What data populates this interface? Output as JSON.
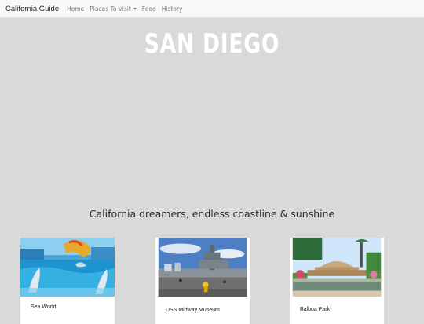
{
  "navbar": {
    "brand": "California Guide",
    "links": [
      {
        "label": "Home"
      },
      {
        "label": "Places To Visit"
      },
      {
        "label": "Food"
      },
      {
        "label": "History"
      }
    ]
  },
  "hero": {
    "title": "SAN DIEGO",
    "tagline": "California dreamers, endless coastline & sunshine"
  },
  "cards": [
    {
      "label": "Sea World"
    },
    {
      "label": "USS Midway Museum"
    },
    {
      "label": "Balboa Park"
    }
  ],
  "colors": {
    "page_background": "#d9d9d9",
    "navbar_background": "#f8f9fa",
    "hero_title": "#ffffff"
  }
}
